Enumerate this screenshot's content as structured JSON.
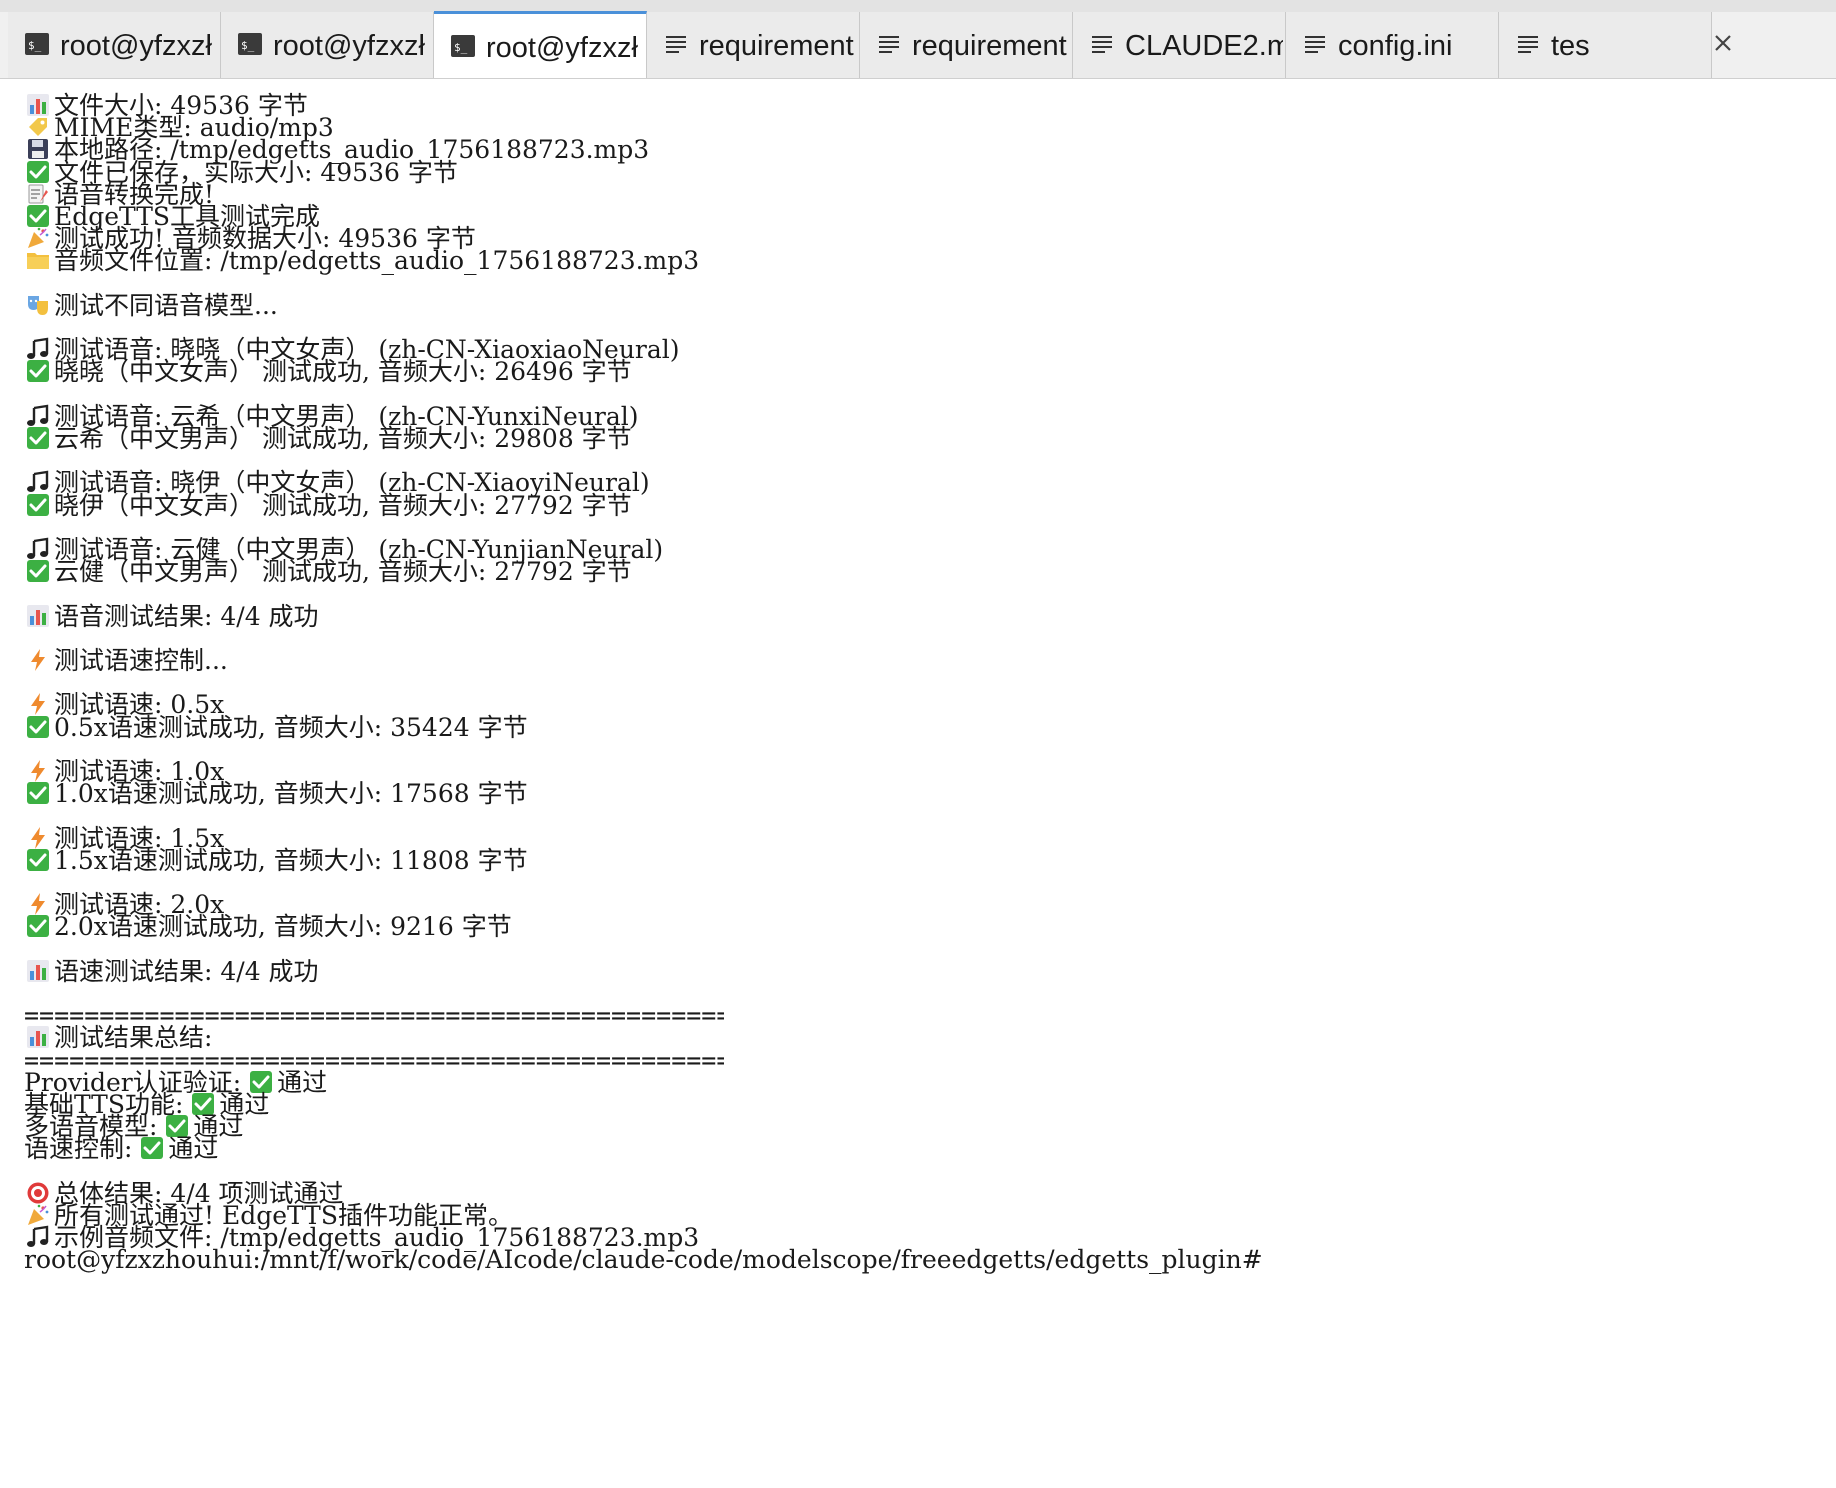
{
  "tabs": [
    {
      "label": "root@yfzxzł",
      "kind": "terminal",
      "active": false
    },
    {
      "label": "root@yfzxzł",
      "kind": "terminal",
      "active": false
    },
    {
      "label": "root@yfzxzł",
      "kind": "terminal",
      "active": true
    },
    {
      "label": "requirement",
      "kind": "document",
      "active": false
    },
    {
      "label": "requirement",
      "kind": "document",
      "active": false
    },
    {
      "label": "CLAUDE2.m",
      "kind": "document",
      "active": false
    },
    {
      "label": "config.ini",
      "kind": "document",
      "active": false
    },
    {
      "label": "tes",
      "kind": "document",
      "active": false
    }
  ],
  "terminal": {
    "lines": [
      {
        "icon": "chart-icon",
        "text": "文件大小: 49536 字节"
      },
      {
        "icon": "tag-icon",
        "text": "MIME类型: audio/mp3"
      },
      {
        "icon": "floppy-icon",
        "text": "本地路径: /tmp/edgetts_audio_1756188723.mp3"
      },
      {
        "icon": "check-icon",
        "text": "文件已保存，实际大小: 49536 字节"
      },
      {
        "icon": "memo-party-icon",
        "text": "语音转换完成!"
      },
      {
        "icon": "check-icon",
        "text": "EdgeTTS工具测试完成"
      },
      {
        "icon": "party-icon",
        "text": "测试成功! 音频数据大小: 49536 字节"
      },
      {
        "icon": "folder-icon",
        "text": "音频文件位置: /tmp/edgetts_audio_1756188723.mp3"
      },
      {
        "icon": "",
        "text": ""
      },
      {
        "icon": "masks-icon",
        "text": "测试不同语音模型..."
      },
      {
        "icon": "",
        "text": ""
      },
      {
        "icon": "music-icon",
        "text": "测试语音: 晓晓（中文女声） (zh-CN-XiaoxiaoNeural)"
      },
      {
        "icon": "check-icon",
        "text": "晓晓（中文女声） 测试成功, 音频大小: 26496 字节"
      },
      {
        "icon": "",
        "text": ""
      },
      {
        "icon": "music-icon",
        "text": "测试语音: 云希（中文男声） (zh-CN-YunxiNeural)"
      },
      {
        "icon": "check-icon",
        "text": "云希（中文男声） 测试成功, 音频大小: 29808 字节"
      },
      {
        "icon": "",
        "text": ""
      },
      {
        "icon": "music-icon",
        "text": "测试语音: 晓伊（中文女声） (zh-CN-XiaoyiNeural)"
      },
      {
        "icon": "check-icon",
        "text": "晓伊（中文女声） 测试成功, 音频大小: 27792 字节"
      },
      {
        "icon": "",
        "text": ""
      },
      {
        "icon": "music-icon",
        "text": "测试语音: 云健（中文男声） (zh-CN-YunjianNeural)"
      },
      {
        "icon": "check-icon",
        "text": "云健（中文男声） 测试成功, 音频大小: 27792 字节"
      },
      {
        "icon": "",
        "text": ""
      },
      {
        "icon": "chart-icon",
        "text": "语音测试结果: 4/4 成功"
      },
      {
        "icon": "",
        "text": ""
      },
      {
        "icon": "bolt-icon",
        "text": "测试语速控制..."
      },
      {
        "icon": "",
        "text": ""
      },
      {
        "icon": "bolt-icon",
        "text": "测试语速: 0.5x"
      },
      {
        "icon": "check-icon",
        "text": "0.5x语速测试成功, 音频大小: 35424 字节"
      },
      {
        "icon": "",
        "text": ""
      },
      {
        "icon": "bolt-icon",
        "text": "测试语速: 1.0x"
      },
      {
        "icon": "check-icon",
        "text": "1.0x语速测试成功, 音频大小: 17568 字节"
      },
      {
        "icon": "",
        "text": ""
      },
      {
        "icon": "bolt-icon",
        "text": "测试语速: 1.5x"
      },
      {
        "icon": "check-icon",
        "text": "1.5x语速测试成功, 音频大小: 11808 字节"
      },
      {
        "icon": "",
        "text": ""
      },
      {
        "icon": "bolt-icon",
        "text": "测试语速: 2.0x"
      },
      {
        "icon": "check-icon",
        "text": "2.0x语速测试成功, 音频大小: 9216 字节"
      },
      {
        "icon": "",
        "text": ""
      },
      {
        "icon": "chart-icon",
        "text": "语速测试结果: 4/4 成功"
      },
      {
        "icon": "",
        "text": ""
      },
      {
        "icon": "",
        "text": "==================================================",
        "rule": true
      },
      {
        "icon": "chart-icon",
        "text": "测试结果总结:"
      },
      {
        "icon": "",
        "text": "==================================================",
        "rule": true
      },
      {
        "icon": "",
        "text": "Provider认证验证: ",
        "suffix_icon": "check-icon",
        "suffix": "通过",
        "flush": true
      },
      {
        "icon": "",
        "text": "基础TTS功能: ",
        "suffix_icon": "check-icon",
        "suffix": "通过",
        "flush": true
      },
      {
        "icon": "",
        "text": "多语音模型: ",
        "suffix_icon": "check-icon",
        "suffix": "通过",
        "flush": true
      },
      {
        "icon": "",
        "text": "语速控制: ",
        "suffix_icon": "check-icon",
        "suffix": "通过",
        "flush": true
      },
      {
        "icon": "",
        "text": ""
      },
      {
        "icon": "target-icon",
        "text": "总体结果: 4/4 项测试通过"
      },
      {
        "icon": "party-icon",
        "text": "所有测试通过! EdgeTTS插件功能正常。"
      },
      {
        "icon": "music-icon",
        "text": "示例音频文件: /tmp/edgetts_audio_1756188723.mp3"
      },
      {
        "icon": "",
        "text": "root@yfzxzhouhui:/mnt/f/work/code/AIcode/claude-code/modelscope/freeedgetts/edgetts_plugin#",
        "flush": true
      }
    ]
  },
  "colors": {
    "check_green": "#3cb043",
    "chart_bars": [
      "#4a90d9",
      "#e8554e",
      "#3cb043"
    ],
    "folder": "#f3c03f",
    "bolt": "#ef8a2e",
    "target_red": "#e03a3a",
    "active_tab_accent": "#4a90d9"
  }
}
